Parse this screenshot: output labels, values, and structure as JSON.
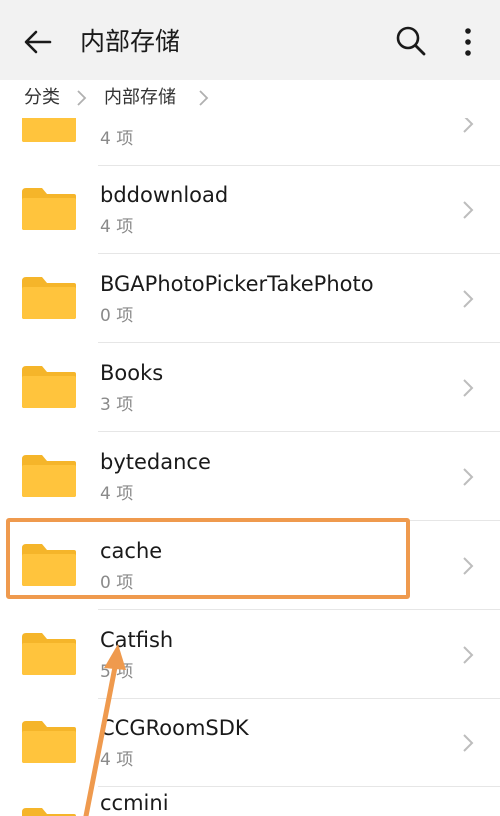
{
  "header": {
    "title": "内部存储"
  },
  "breadcrumb": {
    "items": [
      "分类",
      "内部存储"
    ]
  },
  "folders": [
    {
      "name": "",
      "count": "4 项"
    },
    {
      "name": "bddownload",
      "count": "4 项"
    },
    {
      "name": "BGAPhotoPickerTakePhoto",
      "count": "0 项"
    },
    {
      "name": "Books",
      "count": "3 项"
    },
    {
      "name": "bytedance",
      "count": "4 项"
    },
    {
      "name": "cache",
      "count": "0 项"
    },
    {
      "name": "Catfish",
      "count": "5 项"
    },
    {
      "name": "CCGRoomSDK",
      "count": "4 项"
    },
    {
      "name": "ccmini",
      "count": ""
    }
  ],
  "colors": {
    "folder": "#ffc43d",
    "folder_tab": "#f5b52a",
    "highlight": "#ef9a4e",
    "arrow": "#ef9a4e"
  },
  "icons": {
    "back": "arrow-left-icon",
    "search": "search-icon",
    "more": "more-vert-icon",
    "folder": "folder-icon",
    "chevron": "chevron-right-icon"
  }
}
